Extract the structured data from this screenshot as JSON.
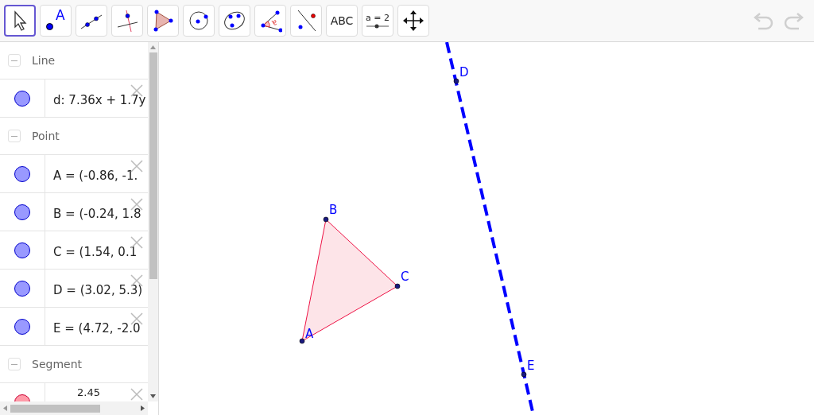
{
  "toolbar": {
    "tools": [
      {
        "kind": "move",
        "selected": true
      },
      {
        "kind": "point",
        "label": "A",
        "selected": false
      },
      {
        "kind": "line",
        "selected": false
      },
      {
        "kind": "perpendicular",
        "selected": false
      },
      {
        "kind": "polygon",
        "selected": false
      },
      {
        "kind": "circle",
        "selected": false
      },
      {
        "kind": "conic",
        "selected": false
      },
      {
        "kind": "angle",
        "selected": false
      },
      {
        "kind": "reflect",
        "selected": false
      },
      {
        "kind": "text",
        "label": "ABC",
        "selected": false
      },
      {
        "kind": "slider",
        "label": "a = 2",
        "selected": false
      },
      {
        "kind": "pan",
        "selected": false
      }
    ]
  },
  "algebra": {
    "groups": [
      {
        "title": "Line",
        "expanded": true,
        "items": [
          {
            "text": "d: 7.36x + 1.7y",
            "color": "#9999ff"
          }
        ]
      },
      {
        "title": "Point",
        "expanded": true,
        "items": [
          {
            "text": "A = (-0.86, -1.",
            "color": "#9999ff"
          },
          {
            "text": "B = (-0.24, 1.8",
            "color": "#9999ff"
          },
          {
            "text": "C = (1.54, 0.1",
            "color": "#9999ff"
          },
          {
            "text": "D = (3.02, 5.3)",
            "color": "#9999ff"
          },
          {
            "text": "E = (4.72, -2.0",
            "color": "#9999ff"
          }
        ]
      },
      {
        "title": "Segment",
        "expanded": true,
        "items": [
          {
            "text": "2.45",
            "color": "#ff9aa8"
          }
        ]
      }
    ]
  },
  "graphics": {
    "points": [
      {
        "label": "A"
      },
      {
        "label": "B"
      },
      {
        "label": "C"
      },
      {
        "label": "D"
      },
      {
        "label": "E"
      }
    ]
  }
}
